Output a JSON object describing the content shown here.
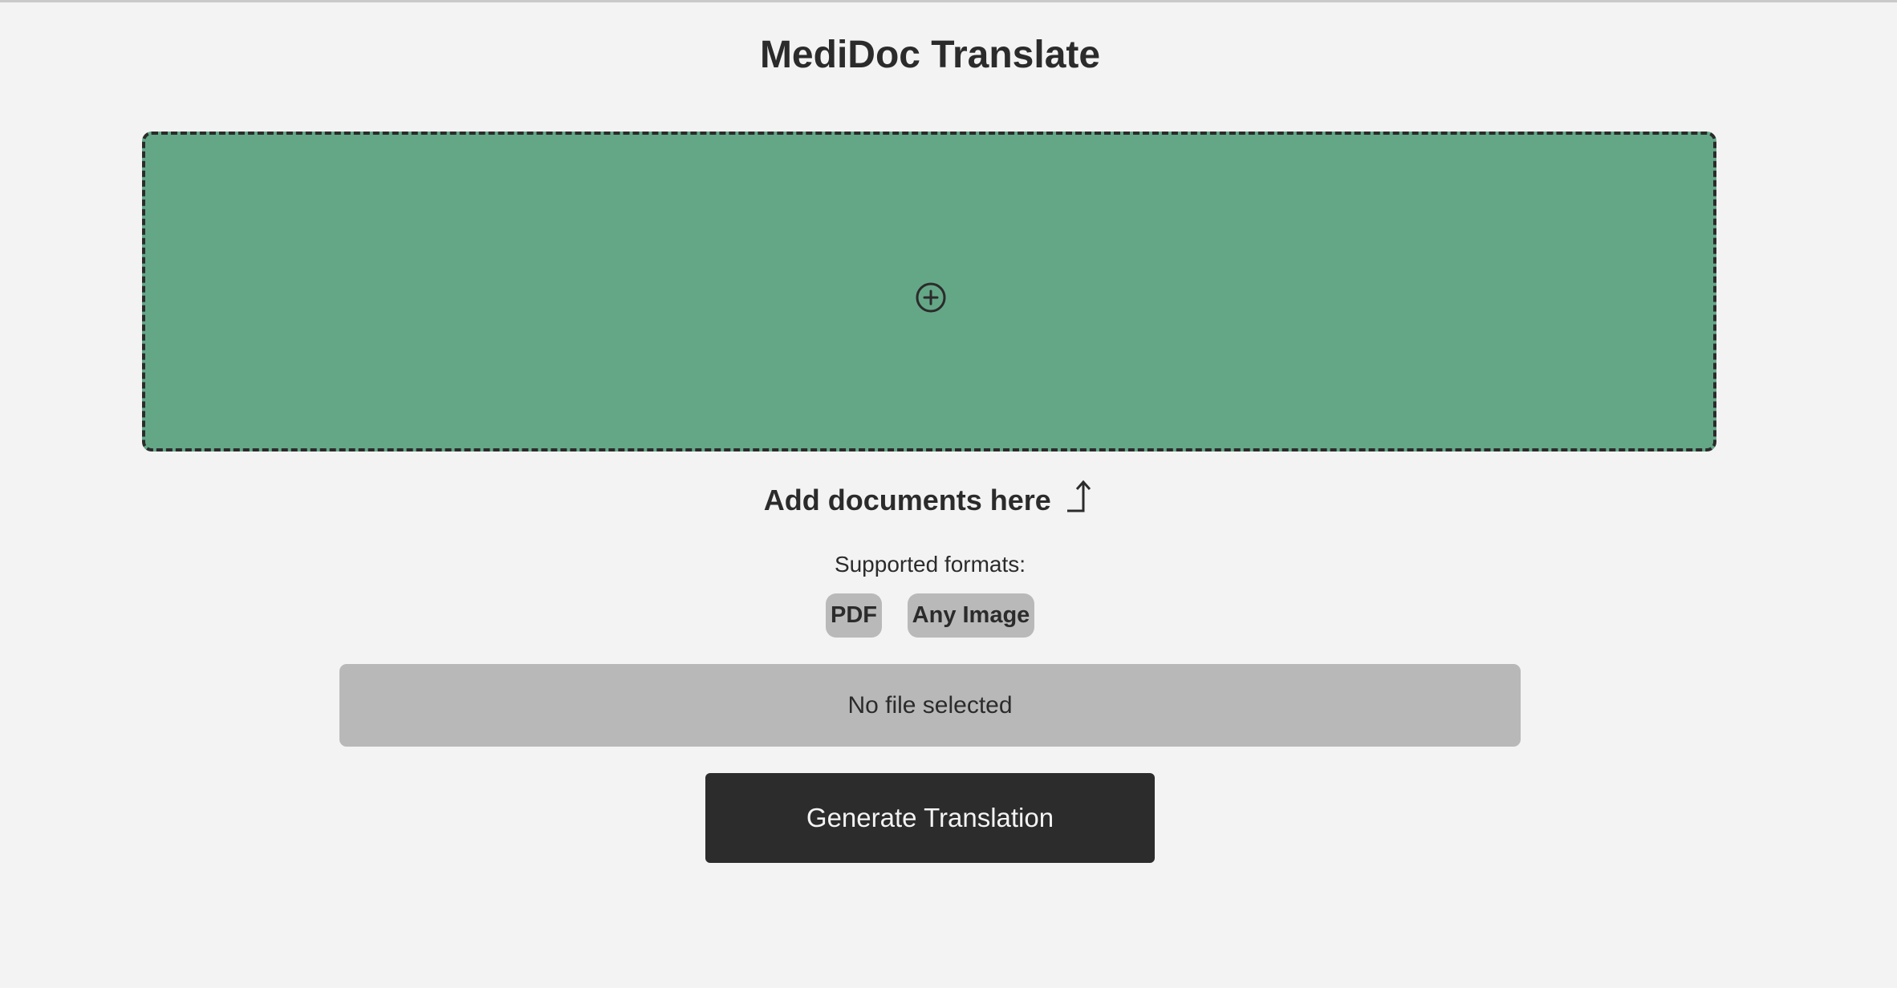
{
  "app": {
    "title": "MediDoc Translate"
  },
  "dropzone": {
    "icon": "plus-circle-icon",
    "accent_color": "#64a787",
    "border_color": "#2b2b2b"
  },
  "upload": {
    "label": "Add documents here",
    "icon": "upload-arrow-icon"
  },
  "formats": {
    "label": "Supported formats:",
    "items": [
      "PDF",
      "Any Image"
    ]
  },
  "file_status": {
    "text": "No file selected"
  },
  "actions": {
    "generate_label": "Generate Translation"
  }
}
